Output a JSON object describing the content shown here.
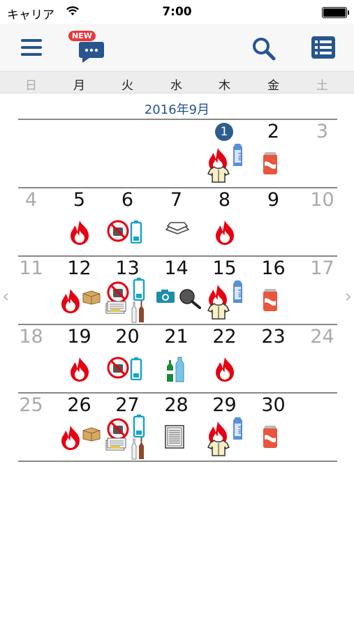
{
  "status_bar": {
    "carrier": "キャリア",
    "time": "7:00"
  },
  "nav": {
    "new_badge": "NEW",
    "icons": [
      "menu-icon",
      "chat-icon",
      "search-icon",
      "list-icon"
    ]
  },
  "weekdays": [
    "日",
    "月",
    "火",
    "水",
    "木",
    "金",
    "土"
  ],
  "calendar": {
    "month_title": "2016年9月",
    "weeks": [
      {
        "days": [
          {
            "n": ""
          },
          {
            "n": ""
          },
          {
            "n": ""
          },
          {
            "n": ""
          },
          {
            "n": "1",
            "today": true,
            "icons": [
              "fire",
              "milk",
              "shirt"
            ]
          },
          {
            "n": "2",
            "icons": [
              "can"
            ]
          },
          {
            "n": "3",
            "gray": true
          }
        ]
      },
      {
        "days": [
          {
            "n": "4",
            "gray": true
          },
          {
            "n": "5",
            "icons": [
              "fire"
            ]
          },
          {
            "n": "6",
            "icons": [
              "no-burn",
              "battery"
            ]
          },
          {
            "n": "7",
            "icons": [
              "tray"
            ]
          },
          {
            "n": "8",
            "icons": [
              "fire"
            ]
          },
          {
            "n": "9"
          },
          {
            "n": "10",
            "gray": true
          }
        ]
      },
      {
        "days": [
          {
            "n": "11",
            "gray": true
          },
          {
            "n": "12",
            "icons": [
              "fire",
              "box"
            ]
          },
          {
            "n": "13",
            "icons": [
              "no-burn",
              "battery",
              "newspaper",
              "bottles"
            ]
          },
          {
            "n": "14",
            "icons": [
              "camera",
              "pan"
            ]
          },
          {
            "n": "15",
            "icons": [
              "fire",
              "milk",
              "shirt"
            ]
          },
          {
            "n": "16",
            "icons": [
              "can"
            ]
          },
          {
            "n": "17",
            "gray": true
          }
        ]
      },
      {
        "days": [
          {
            "n": "18",
            "gray": true
          },
          {
            "n": "19",
            "icons": [
              "fire"
            ]
          },
          {
            "n": "20",
            "icons": [
              "no-burn",
              "battery"
            ]
          },
          {
            "n": "21",
            "icons": [
              "pet-bottles"
            ]
          },
          {
            "n": "22",
            "icons": [
              "fire"
            ]
          },
          {
            "n": "23"
          },
          {
            "n": "24",
            "gray": true
          }
        ]
      },
      {
        "days": [
          {
            "n": "25",
            "gray": true
          },
          {
            "n": "26",
            "icons": [
              "fire",
              "box"
            ]
          },
          {
            "n": "27",
            "icons": [
              "no-burn",
              "battery",
              "newspaper",
              "bottles"
            ]
          },
          {
            "n": "28",
            "icons": [
              "paper"
            ]
          },
          {
            "n": "29",
            "icons": [
              "fire",
              "milk",
              "shirt"
            ]
          },
          {
            "n": "30",
            "icons": [
              "can"
            ]
          },
          {
            "n": ""
          }
        ]
      }
    ]
  },
  "colors": {
    "accent": "#26558f",
    "fire": "#e60012",
    "battery": "#1aa3c9",
    "today": "#2e5d8f"
  }
}
